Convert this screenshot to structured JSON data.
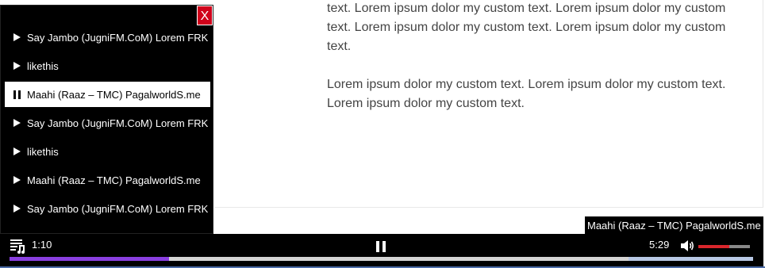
{
  "article": {
    "paragraph1": "text. Lorem ipsum dolor my custom text. Lorem ipsum dolor my custom text. Lorem ipsum dolor my custom text. Lorem ipsum dolor my custom text.",
    "paragraph2": "Lorem ipsum dolor my custom text. Lorem ipsum dolor my custom text. Lorem ipsum dolor my custom text."
  },
  "playlist": {
    "close_label": "X",
    "items": [
      {
        "label": "Say Jambo (JugniFM.CoM) Lorem FRK",
        "icon": "play-icon"
      },
      {
        "label": "likethis",
        "icon": "play-icon"
      },
      {
        "label": "Maahi (Raaz – TMC) PagalworldS.me",
        "icon": "pause-icon",
        "active": true
      },
      {
        "label": "Say Jambo (JugniFM.CoM) Lorem FRK",
        "icon": "play-icon"
      },
      {
        "label": "likethis",
        "icon": "play-icon"
      },
      {
        "label": "Maahi (Raaz – TMC) PagalworldS.me",
        "icon": "play-icon"
      },
      {
        "label": "Say Jambo (JugniFM.CoM) Lorem FRK",
        "icon": "play-icon"
      }
    ]
  },
  "player": {
    "now_playing_tooltip": "Maahi (Raaz – TMC) PagalworldS.me",
    "current_time": "1:10",
    "total_time": "5:29",
    "progress_fraction": 0.215,
    "volume_fraction": 0.6,
    "colors": {
      "progress": "#8a3fe0",
      "volume": "#d9262c",
      "close_button": "#d0021b"
    }
  }
}
